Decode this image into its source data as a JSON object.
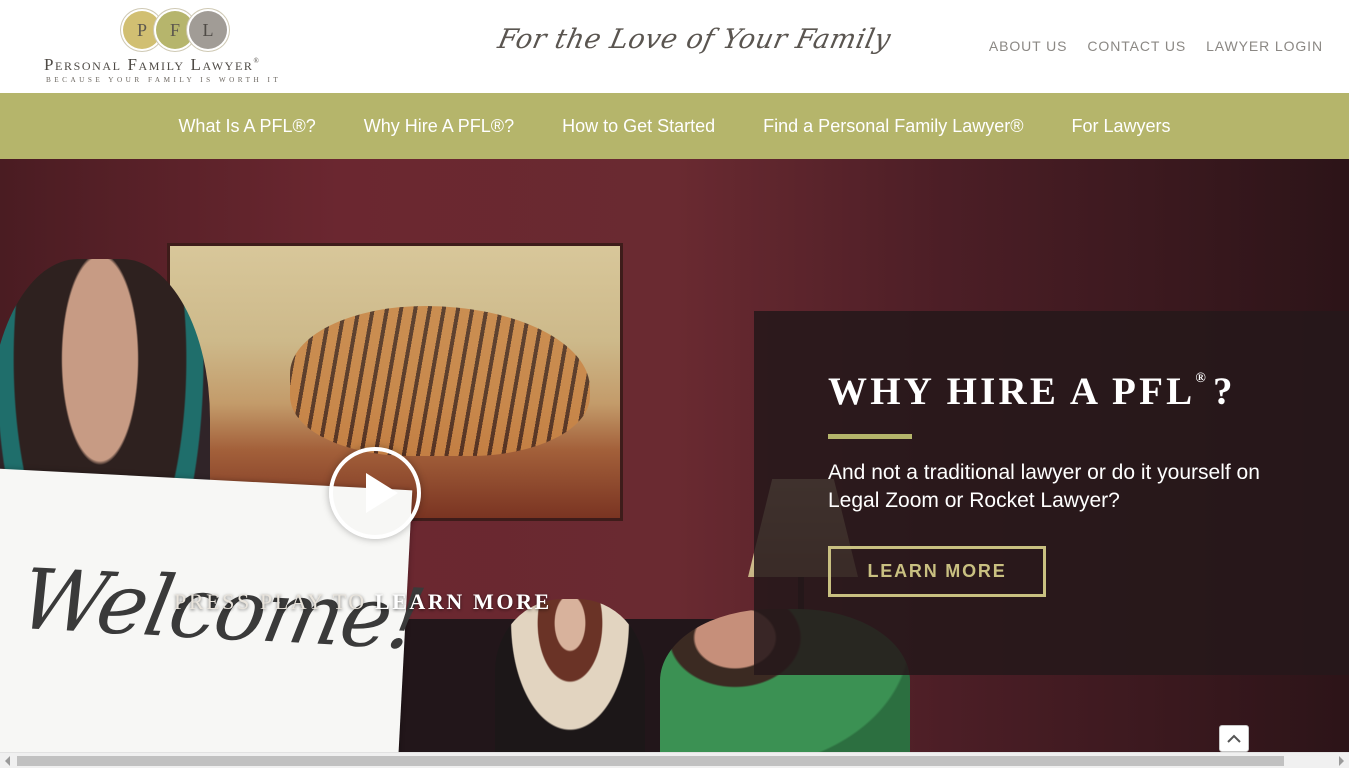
{
  "header": {
    "logo": {
      "initials": [
        "P",
        "F",
        "L"
      ],
      "name": "Personal Family Lawyer",
      "registered_mark": "®",
      "tagline": "BECAUSE YOUR FAMILY IS WORTH IT"
    },
    "script_tagline": "For the Love of Your Family",
    "utility_links": [
      "ABOUT US",
      "CONTACT US",
      "LAWYER LOGIN"
    ]
  },
  "main_nav": {
    "items": [
      "What Is A PFL®?",
      "Why Hire A PFL®?",
      "How to Get Started",
      "Find a Personal Family Lawyer®",
      "For Lawyers"
    ]
  },
  "hero": {
    "sign_text": "Welcome!",
    "press_play_light": "PRESS PLAY TO",
    "press_play_bold": "LEARN MORE",
    "cta": {
      "heading": "WHY HIRE A PFL",
      "heading_mark": "®",
      "heading_end": "?",
      "subheading": "And not a traditional lawyer or do it yourself on Legal Zoom or Rocket Lawyer?",
      "button": "LEARN MORE"
    }
  },
  "colors": {
    "nav_bg": "#b5b56b",
    "accent": "#c9c081",
    "cta_overlay": "#26181a",
    "utility_link": "#8b8884"
  },
  "icons": {
    "play": "play-icon",
    "scroll_top": "chevron-up-icon"
  }
}
